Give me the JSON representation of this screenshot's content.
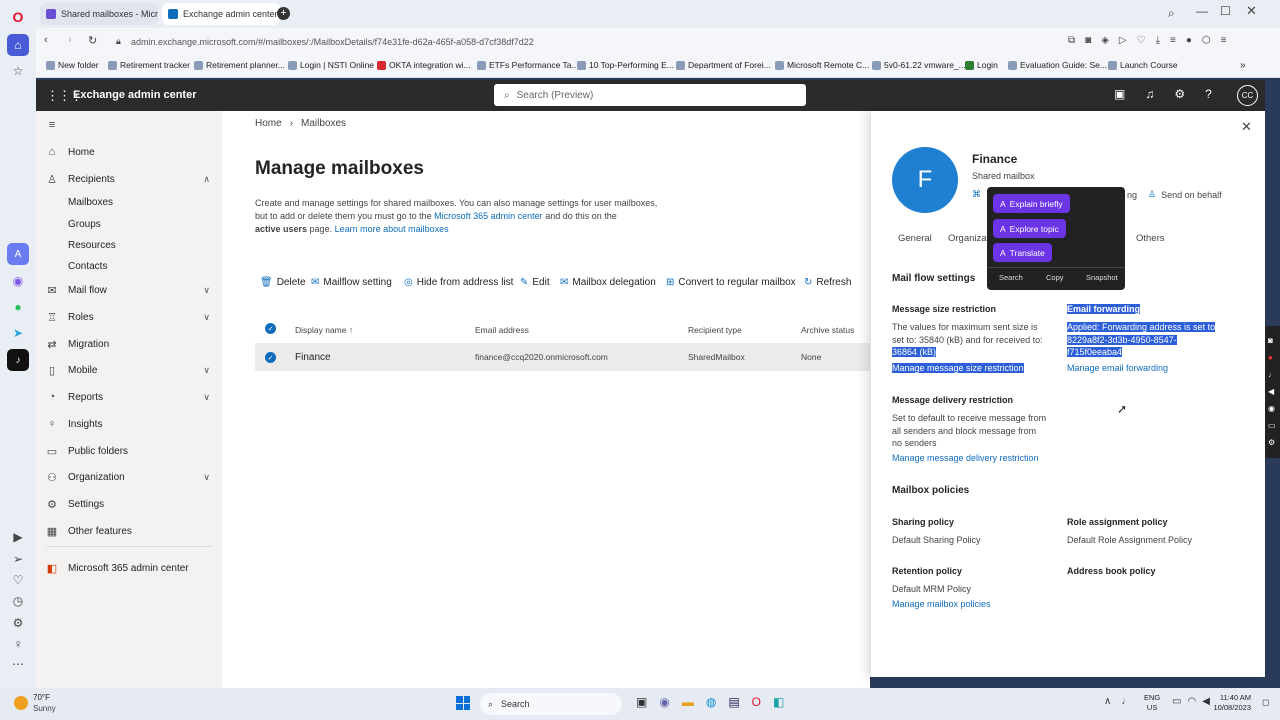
{
  "browser": {
    "tabs": [
      {
        "label": "Shared mailboxes - Micr"
      },
      {
        "label": "Exchange admin center"
      }
    ],
    "url": "admin.exchange.microsoft.com/#/mailboxes/:/MailboxDetails/f74e31fe-d62a-465f-a058-d7cf38df7d22",
    "bookmarks": [
      "New folder",
      "Retirement tracker",
      "Retirement planner...",
      "Login | NSTI Online",
      "OKTA integration wi...",
      "ETFs Performance Ta...",
      "10 Top-Performing E...",
      "Department of Forei...",
      "Microsoft Remote C...",
      "5v0-61.22 vmware_...",
      "Login",
      "Evaluation Guide: Se...",
      "Launch Course"
    ]
  },
  "header": {
    "app_title": "Exchange admin center",
    "search_placeholder": "Search (Preview)",
    "avatar": "CC"
  },
  "nav": {
    "home": "Home",
    "recipients": "Recipients",
    "recipients_sub": [
      "Mailboxes",
      "Groups",
      "Resources",
      "Contacts"
    ],
    "mail_flow": "Mail flow",
    "roles": "Roles",
    "migration": "Migration",
    "mobile": "Mobile",
    "reports": "Reports",
    "insights": "Insights",
    "public_folders": "Public folders",
    "organization": "Organization",
    "settings": "Settings",
    "other_features": "Other features",
    "m365": "Microsoft 365 admin center"
  },
  "main": {
    "breadcrumb_home": "Home",
    "breadcrumb_current": "Mailboxes",
    "title": "Manage mailboxes",
    "desc_line1": "Create and manage settings for shared mailboxes. You can also manage settings for user mailboxes,",
    "desc_line2_pre": "but to add or delete them you must go to the ",
    "desc_line2_link": "Microsoft 365 admin center",
    "desc_line2_post": " and do this on the",
    "desc_line3_bold": "active users",
    "desc_line3_mid": " page. ",
    "desc_line3_link": "Learn more about mailboxes",
    "commands": [
      "Delete",
      "Mailflow setting",
      "Hide from address list",
      "Edit",
      "Mailbox delegation",
      "Convert to regular mailbox",
      "Refresh"
    ],
    "columns": [
      "Display name",
      "Email address",
      "Recipient type",
      "Archive status"
    ],
    "rows": [
      {
        "name": "Finance",
        "email": "finance@ccq2020.onmicrosoft.com",
        "type": "SharedMailbox",
        "archive": "None"
      }
    ]
  },
  "panel": {
    "avatar_letter": "F",
    "name": "Finance",
    "subtitle": "Shared mailbox",
    "action_partial": "ng",
    "send_on_behalf": "Send on behalf",
    "tabs": [
      "General",
      "Organizat",
      "Others"
    ],
    "mail_flow_heading": "Mail flow settings",
    "size_label": "Message size restriction",
    "size_text1": "The values for maximum sent size is",
    "size_text2": "set to: 35840 (kB) and for received to:",
    "size_text3": "36864 (kB)",
    "size_link": "Manage message size restriction",
    "fwd_label": "Email forwarding",
    "fwd_text1": "Applied: Forwarding address is set to",
    "fwd_text2": "8229a8f2-3d3b-4950-8547-",
    "fwd_text3": "f715f0eeaba4",
    "fwd_link": "Manage email forwarding",
    "delivery_label": "Message delivery restriction",
    "delivery_text1": "Set to default to receive message from",
    "delivery_text2": "all senders and block message from",
    "delivery_text3": "no senders",
    "delivery_link": "Manage message delivery restriction",
    "policies_heading": "Mailbox policies",
    "sharing_label": "Sharing policy",
    "sharing_value": "Default Sharing Policy",
    "role_label": "Role assignment policy",
    "role_value": "Default Role Assignment Policy",
    "retention_label": "Retention policy",
    "retention_value": "Default MRM Policy",
    "addressbook_label": "Address book policy",
    "policies_link": "Manage mailbox policies"
  },
  "popup": {
    "buttons": [
      "Explain briefly",
      "Explore topic",
      "Translate"
    ],
    "footer": [
      "Search",
      "Copy",
      "Snapshot"
    ]
  },
  "taskbar": {
    "temp": "70°F",
    "weather": "Sunny",
    "search": "Search",
    "lang1": "ENG",
    "lang2": "US",
    "time": "11:40 AM",
    "date": "10/08/2023"
  },
  "colors": {
    "accent": "#0f6cbd",
    "header_bg": "#2b2b2b",
    "avatar_bg": "#1f7fd1",
    "popup_btn": "#6b34e6",
    "selection": "#2c5fd8"
  }
}
